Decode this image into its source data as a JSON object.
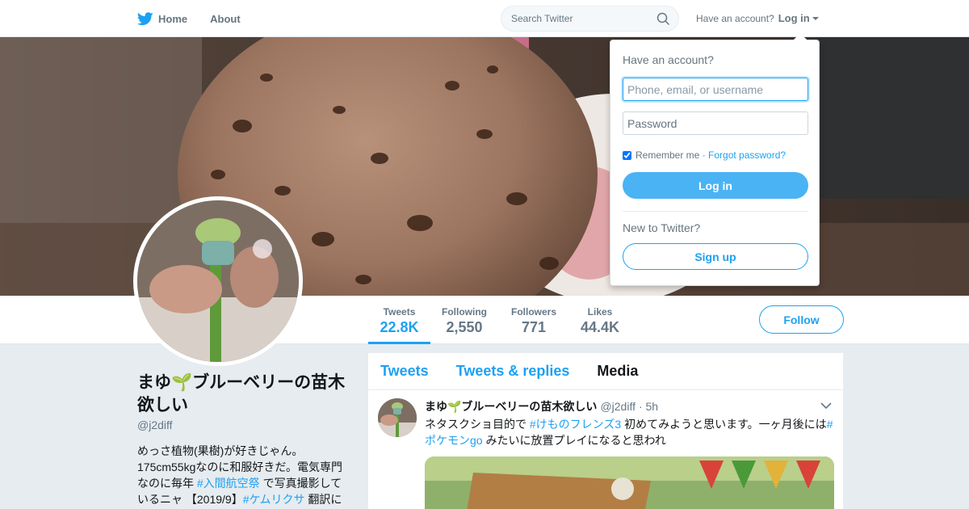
{
  "nav": {
    "home_label": "Home",
    "about_label": "About",
    "search_placeholder": "Search Twitter",
    "have_account": "Have an account?",
    "login_label": "Log in"
  },
  "profile": {
    "name": "まゆ🌱ブルーベリーの苗木欲しい",
    "handle": "@j2diff",
    "bio_part1": "めっさ植物(果樹)が好きじゃん。175cm55kgなのに和服好きだ。電気専門なのに毎年 ",
    "bio_tag1": "#入間航空祭",
    "bio_part2": " で写真撮影しているニャ 【2019/9】",
    "bio_tag2": "#ケムリクサ",
    "bio_part3": " 翻訳に"
  },
  "stats": [
    {
      "label": "Tweets",
      "value": "22.8K"
    },
    {
      "label": "Following",
      "value": "2,550"
    },
    {
      "label": "Followers",
      "value": "771"
    },
    {
      "label": "Likes",
      "value": "44.4K"
    }
  ],
  "follow_label": "Follow",
  "timeline": {
    "tabs": [
      "Tweets",
      "Tweets & replies",
      "Media"
    ],
    "active_tab": "Media"
  },
  "tweet": {
    "name": "まゆ🌱ブルーベリーの苗木欲しい",
    "handle": "@j2diff",
    "time": "· 5h",
    "text_part1": "ネタスクショ目的で ",
    "tag1": "#けものフレンズ3",
    "text_part2": " 初めてみようと思います。一ヶ月後には",
    "tag2": "#ポケモンgo",
    "text_part3": " みたいに放置プレイになると思われ"
  },
  "login_dropdown": {
    "title": "Have an account?",
    "username_placeholder": "Phone, email, or username",
    "password_placeholder": "Password",
    "remember_label": "Remember me",
    "separator": " · ",
    "forgot_label": "Forgot password?",
    "login_button": "Log in",
    "new_label": "New to Twitter?",
    "signup_button": "Sign up"
  },
  "colors": {
    "accent": "#1da1f2",
    "login_button": "#4ab3f4",
    "background": "#e6ecf0"
  }
}
